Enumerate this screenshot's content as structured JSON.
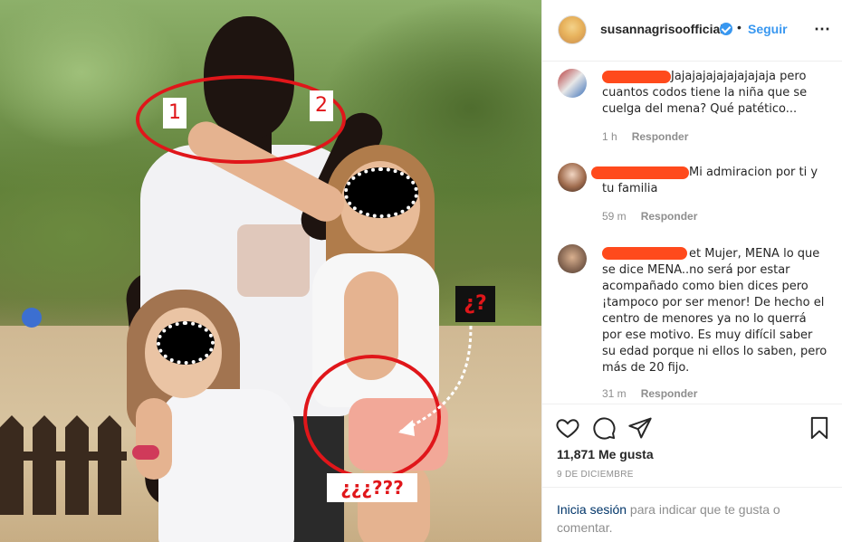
{
  "photo": {
    "annotations": {
      "tag_1": "1",
      "tag_2": "2",
      "question_box": "¿?",
      "question_caption": "¿¿¿???"
    },
    "colors": {
      "highlight_red": "#e0161a"
    }
  },
  "post": {
    "username": "susannagrisoofficial",
    "separator": "•",
    "follow_label": "Seguir",
    "more_icon": "⋯",
    "icons": {
      "verified": "verified-badge-icon",
      "more": "more-options-icon"
    }
  },
  "comments": [
    {
      "text": "Jajajajajajajajajaja pero cuantos codos tiene la niña que se cuelga del mena? Qué patético...",
      "time": "1 h",
      "reply_label": "Responder"
    },
    {
      "text": "Mi admiracion por ti y tu familia",
      "time": "59 m",
      "reply_label": "Responder"
    },
    {
      "text": "et Mujer, MENA lo que se dice MENA..no será por estar acompañado como bien dices pero ¡tampoco por ser menor! De hecho el centro de menores ya no lo querrá por ese motivo. Es muy difícil saber su edad porque ni ellos lo saben, pero más de 20 fijo.",
      "time": "31 m",
      "reply_label": "Responder"
    }
  ],
  "actions": {
    "icons": [
      "heart-icon",
      "comment-icon",
      "share-icon",
      "bookmark-icon"
    ],
    "likes": "11,871 Me gusta",
    "date": "9 DE DICIEMBRE"
  },
  "login": {
    "link": "Inicia sesión",
    "text": " para indicar que te gusta o comentar."
  },
  "colors": {
    "accent": "#3897f0",
    "redaction": "#ff4a1c",
    "muted": "#8e8e8e",
    "border": "#efefef"
  }
}
